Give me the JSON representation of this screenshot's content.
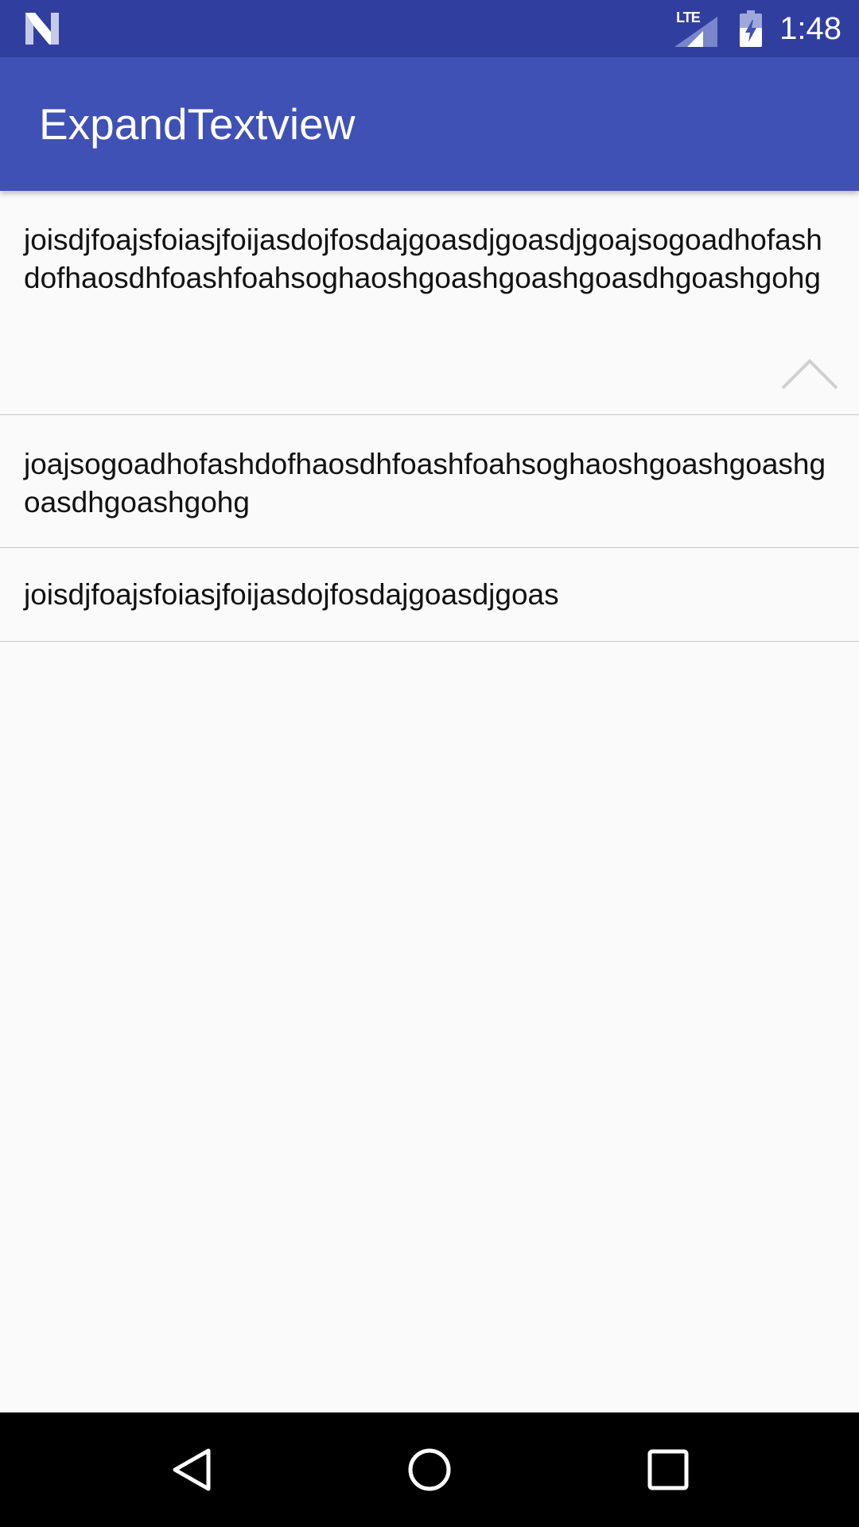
{
  "status_bar": {
    "network_label": "LTE",
    "time": "1:48",
    "icons": [
      "notification-n-icon",
      "signal-icon",
      "battery-charging-icon"
    ]
  },
  "app_bar": {
    "title": "ExpandTextview"
  },
  "list": {
    "items": [
      {
        "text": "joisdjfoajsfoiasjfoijasdojfosdajgoasdjgoasdjgoajsogoadhofashdofhaosdhfoashfoahsoghaoshgoashgoashgoasdhgoashgohg",
        "expanded": true,
        "toggle_icon": "chevron-up-icon"
      },
      {
        "text": "joajsogoadhofashdofhaosdhfoashfoahsoghaoshgoashgoashgoasdhgoashgohg"
      },
      {
        "text": "joisdjfoajsfoiasjfoijasdojfosdajgoasdjgoas"
      }
    ]
  },
  "nav_bar": {
    "icons": [
      "back-icon",
      "home-icon",
      "recents-icon"
    ]
  },
  "colors": {
    "status_bar": "#303f9f",
    "app_bar": "#3f51b5",
    "background": "#fafafa",
    "divider": "#c8c8c8",
    "text": "#111111"
  }
}
